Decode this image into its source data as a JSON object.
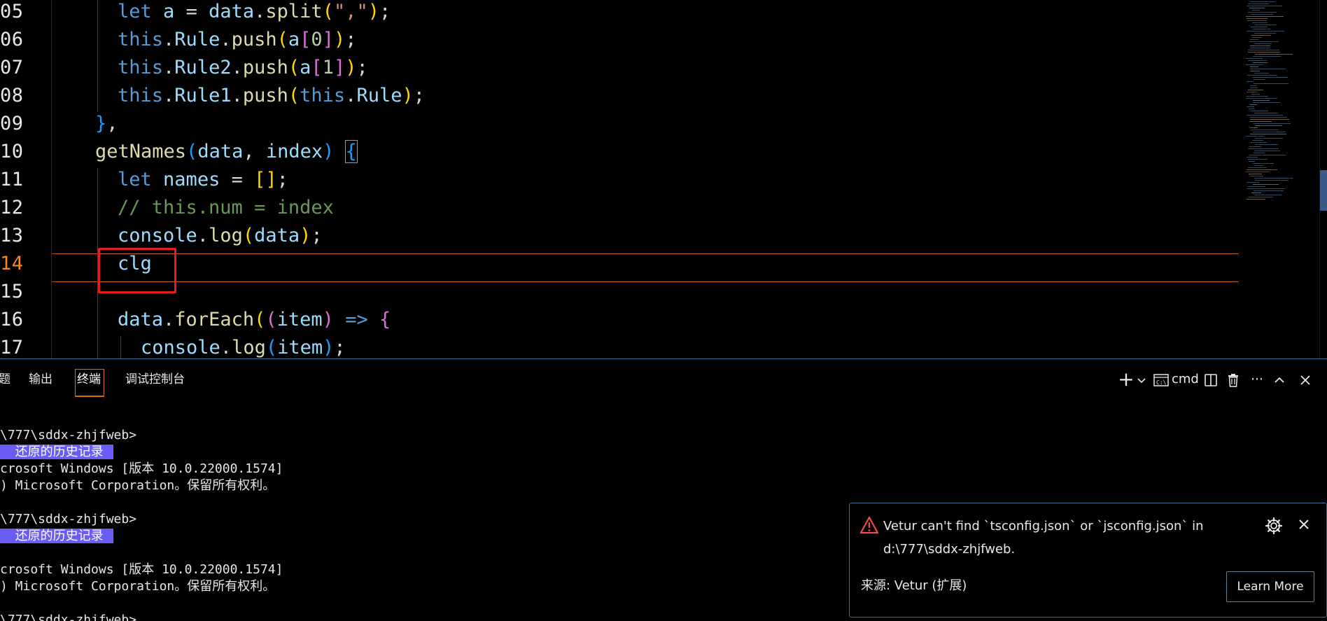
{
  "editor": {
    "line_numbers": [
      "05",
      "06",
      "07",
      "08",
      "09",
      "10",
      "11",
      "12",
      "13",
      "14",
      "15",
      "16",
      "17"
    ],
    "active_line": "14",
    "code_lines": [
      {
        "tokens": [
          [
            "kw",
            "let"
          ],
          [
            "op",
            " "
          ],
          [
            "var",
            "a"
          ],
          [
            "op",
            " = "
          ],
          [
            "var",
            "data"
          ],
          [
            "op",
            "."
          ],
          [
            "fn",
            "split"
          ],
          [
            "p1",
            "("
          ],
          [
            "str",
            "\",\""
          ],
          [
            "p1",
            ")"
          ],
          [
            "op",
            ";"
          ]
        ]
      },
      {
        "tokens": [
          [
            "this",
            "this"
          ],
          [
            "op",
            "."
          ],
          [
            "var",
            "Rule"
          ],
          [
            "op",
            "."
          ],
          [
            "fn",
            "push"
          ],
          [
            "p1",
            "("
          ],
          [
            "var",
            "a"
          ],
          [
            "p2",
            "["
          ],
          [
            "num",
            "0"
          ],
          [
            "p2",
            "]"
          ],
          [
            "p1",
            ")"
          ],
          [
            "op",
            ";"
          ]
        ]
      },
      {
        "tokens": [
          [
            "this",
            "this"
          ],
          [
            "op",
            "."
          ],
          [
            "var",
            "Rule2"
          ],
          [
            "op",
            "."
          ],
          [
            "fn",
            "push"
          ],
          [
            "p1",
            "("
          ],
          [
            "var",
            "a"
          ],
          [
            "p2",
            "["
          ],
          [
            "num",
            "1"
          ],
          [
            "p2",
            "]"
          ],
          [
            "p1",
            ")"
          ],
          [
            "op",
            ";"
          ]
        ]
      },
      {
        "tokens": [
          [
            "this",
            "this"
          ],
          [
            "op",
            "."
          ],
          [
            "var",
            "Rule1"
          ],
          [
            "op",
            "."
          ],
          [
            "fn",
            "push"
          ],
          [
            "p1",
            "("
          ],
          [
            "this",
            "this"
          ],
          [
            "op",
            "."
          ],
          [
            "var",
            "Rule"
          ],
          [
            "p1",
            ")"
          ],
          [
            "op",
            ";"
          ]
        ]
      },
      {
        "tokens": [
          [
            "p3",
            "}"
          ],
          [
            "op",
            ","
          ]
        ]
      },
      {
        "tokens": [
          [
            "fn",
            "getNames"
          ],
          [
            "p3",
            "("
          ],
          [
            "var",
            "data"
          ],
          [
            "op",
            ", "
          ],
          [
            "var",
            "index"
          ],
          [
            "p3",
            ")"
          ],
          [
            "op",
            " "
          ],
          [
            "p3",
            "{"
          ]
        ]
      },
      {
        "tokens": [
          [
            "kw",
            "let"
          ],
          [
            "op",
            " "
          ],
          [
            "var",
            "names"
          ],
          [
            "op",
            " = "
          ],
          [
            "p1",
            "[]"
          ],
          [
            "op",
            ";"
          ]
        ]
      },
      {
        "tokens": [
          [
            "cmt",
            "// this.num = index"
          ]
        ]
      },
      {
        "tokens": [
          [
            "var",
            "console"
          ],
          [
            "op",
            "."
          ],
          [
            "fn",
            "log"
          ],
          [
            "p1",
            "("
          ],
          [
            "var",
            "data"
          ],
          [
            "p1",
            ")"
          ],
          [
            "op",
            ";"
          ]
        ]
      },
      {
        "tokens": [
          [
            "var",
            "clg"
          ]
        ]
      },
      {
        "tokens": []
      },
      {
        "tokens": [
          [
            "var",
            "data"
          ],
          [
            "op",
            "."
          ],
          [
            "fn",
            "forEach"
          ],
          [
            "p1",
            "("
          ],
          [
            "p2",
            "("
          ],
          [
            "var",
            "item"
          ],
          [
            "p2",
            ")"
          ],
          [
            "op",
            " "
          ],
          [
            "kw",
            "=>"
          ],
          [
            "op",
            " "
          ],
          [
            "p2",
            "{"
          ]
        ]
      },
      {
        "tokens": [
          [
            "var",
            "console"
          ],
          [
            "op",
            "."
          ],
          [
            "fn",
            "log"
          ],
          [
            "p3",
            "("
          ],
          [
            "var",
            "item"
          ],
          [
            "p3",
            ")"
          ],
          [
            "op",
            ";"
          ]
        ]
      }
    ]
  },
  "panel": {
    "tabs": [
      {
        "label": "题",
        "active": false
      },
      {
        "label": "输出",
        "active": false
      },
      {
        "label": "终端",
        "active": true
      },
      {
        "label": "调试控制台",
        "active": false
      }
    ],
    "toolbar": {
      "new_terminal_icon": "plus-icon",
      "dropdown_icon": "chevron-down-icon",
      "terminal_name": "cmd",
      "split_icon": "split-icon",
      "trash_icon": "trash-icon",
      "more_icon": "ellipsis-icon",
      "maximize_icon": "chevron-up-icon",
      "close_icon": "close-icon"
    },
    "terminal_lines": [
      "\\777\\sddx-zhjfweb>",
      "  还原的历史记录",
      "crosoft Windows [版本 10.0.22000.1574]",
      ") Microsoft Corporation。保留所有权利。",
      "",
      "\\777\\sddx-zhjfweb>",
      "  还原的历史记录",
      "",
      "crosoft Windows [版本 10.0.22000.1574]",
      ") Microsoft Corporation。保留所有权利。",
      "",
      "\\777\\sddx-zhjfweb>"
    ]
  },
  "notification": {
    "message": "Vetur can't find `tsconfig.json` or `jsconfig.json` in d:\\777\\sddx-zhjfweb.",
    "source": "来源: Vetur (扩展)",
    "button_label": "Learn More",
    "icon": "warning-icon",
    "settings_icon": "gear-icon",
    "close_icon": "close-icon"
  },
  "colors": {
    "accent_active_line": "#f08a24",
    "highlight_box": "#e21e1e",
    "restore_badge": "#6a5cf5",
    "panel_border": "#3b6f9a"
  }
}
